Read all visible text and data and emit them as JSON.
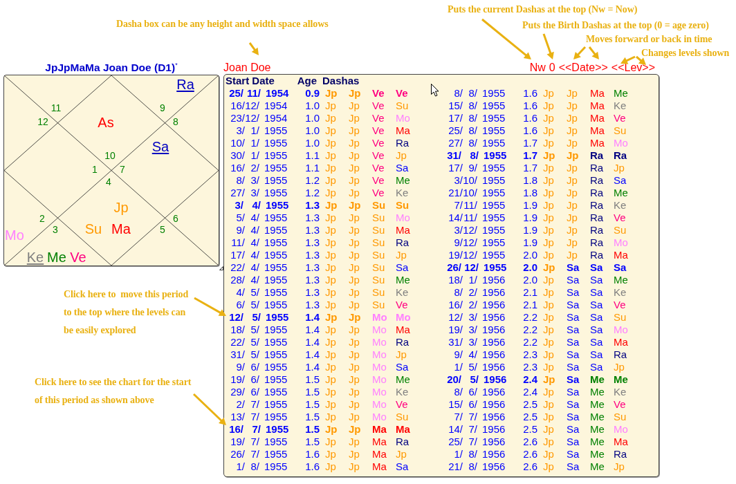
{
  "chart": {
    "title": "JpJpMaMa Joan Doe (D1)$^{*}$",
    "houses": [
      {
        "sign": "9",
        "planets": [
          {
            "name": "Ra",
            "color": "#0000c0",
            "underlined": true
          }
        ]
      },
      {
        "sign": "10",
        "planets": [
          {
            "name": "As",
            "color": "#ff0000",
            "underlined": false
          }
        ]
      },
      {
        "sign": "11"
      },
      {
        "sign": "12"
      },
      {
        "sign": "8"
      },
      {
        "sign": "1"
      },
      {
        "sign": "7",
        "planets": [
          {
            "name": "Sa",
            "color": "#0000c0",
            "underlined": true
          }
        ]
      },
      {
        "sign": "4",
        "planets": [
          {
            "name": "Jp",
            "color": "#ff9900",
            "underlined": false
          },
          {
            "name": "Su",
            "color": "#ff9900",
            "underlined": false
          },
          {
            "name": "Ma",
            "color": "#ff0000",
            "underlined": false
          }
        ]
      },
      {
        "sign": "2",
        "planets": [
          {
            "name": "Mo",
            "color": "#ff80ff",
            "underlined": false
          }
        ]
      },
      {
        "sign": "6"
      },
      {
        "sign": "3",
        "planets": [
          {
            "name": "Ke",
            "color": "#808080",
            "underlined": true
          },
          {
            "name": "Me",
            "color": "#008000",
            "underlined": false
          },
          {
            "name": "Ve",
            "color": "#ff0080",
            "underlined": false
          }
        ]
      },
      {
        "sign": "5"
      }
    ]
  },
  "dasha_panel": {
    "name": "Joan Doe",
    "navigation": [
      {
        "kind": "link",
        "label": "Nw"
      },
      {
        "kind": "link",
        "label": "0"
      },
      {
        "kind": "stepper",
        "back": "<<",
        "label": "Date",
        "forward": ">>"
      },
      {
        "kind": "stepper",
        "back": "<<",
        "label": "Lev",
        "forward": ">>"
      }
    ],
    "table": {
      "columns": [
        "Start Date",
        "Age",
        "Dashas"
      ],
      "rows": [
        {
          "start_date": "25/ 11/ 1954",
          "age": "0.9",
          "bold": true,
          "dashas": [
            {
              "text": "Jp",
              "color": "#ff9900"
            },
            {
              "text": "Jp",
              "color": "#ff9900"
            },
            {
              "text": "Ve",
              "color": "#ff0080"
            },
            {
              "text": "Ve",
              "color": "#ff0080"
            }
          ]
        },
        {
          "start_date": "16/12/ 1954",
          "age": "1.0",
          "bold": false,
          "dashas": [
            {
              "text": "Jp",
              "color": "#ff9900"
            },
            {
              "text": "Jp",
              "color": "#ff9900"
            },
            {
              "text": "Ve",
              "color": "#ff0080"
            },
            {
              "text": "Su",
              "color": "#ff9900"
            }
          ]
        },
        {
          "start_date": "23/12/ 1954",
          "age": "1.0",
          "bold": false,
          "dashas": [
            {
              "text": "Jp",
              "color": "#ff9900"
            },
            {
              "text": "Jp",
              "color": "#ff9900"
            },
            {
              "text": "Ve",
              "color": "#ff0080"
            },
            {
              "text": "Mo",
              "color": "#ff80ff"
            }
          ]
        },
        {
          "start_date": "3/ 1/ 1955",
          "age": "1.0",
          "bold": false,
          "dashas": [
            {
              "text": "Jp",
              "color": "#ff9900"
            },
            {
              "text": "Jp",
              "color": "#ff9900"
            },
            {
              "text": "Ve",
              "color": "#ff0080"
            },
            {
              "text": "Ma",
              "color": "#ff0000"
            }
          ]
        },
        {
          "start_date": "10/ 1/ 1955",
          "age": "1.0",
          "bold": false,
          "dashas": [
            {
              "text": "Jp",
              "color": "#ff9900"
            },
            {
              "text": "Jp",
              "color": "#ff9900"
            },
            {
              "text": "Ve",
              "color": "#ff0080"
            },
            {
              "text": "Ra",
              "color": "#000080"
            }
          ]
        },
        {
          "start_date": "30/ 1/ 1955",
          "age": "1.1",
          "bold": false,
          "dashas": [
            {
              "text": "Jp",
              "color": "#ff9900"
            },
            {
              "text": "Jp",
              "color": "#ff9900"
            },
            {
              "text": "Ve",
              "color": "#ff0080"
            },
            {
              "text": "Jp",
              "color": "#ff9900"
            }
          ]
        },
        {
          "start_date": "16/ 2/ 1955",
          "age": "1.1",
          "bold": false,
          "dashas": [
            {
              "text": "Jp",
              "color": "#ff9900"
            },
            {
              "text": "Jp",
              "color": "#ff9900"
            },
            {
              "text": "Ve",
              "color": "#ff0080"
            },
            {
              "text": "Sa",
              "color": "#0000ff"
            }
          ]
        },
        {
          "start_date": "8/ 3/ 1955",
          "age": "1.2",
          "bold": false,
          "dashas": [
            {
              "text": "Jp",
              "color": "#ff9900"
            },
            {
              "text": "Jp",
              "color": "#ff9900"
            },
            {
              "text": "Ve",
              "color": "#ff0080"
            },
            {
              "text": "Me",
              "color": "#008000"
            }
          ]
        },
        {
          "start_date": "27/ 3/ 1955",
          "age": "1.2",
          "bold": false,
          "dashas": [
            {
              "text": "Jp",
              "color": "#ff9900"
            },
            {
              "text": "Jp",
              "color": "#ff9900"
            },
            {
              "text": "Ve",
              "color": "#ff0080"
            },
            {
              "text": "Ke",
              "color": "#808080"
            }
          ]
        },
        {
          "start_date": "3/ 4/ 1955",
          "age": "1.3",
          "bold": true,
          "dashas": [
            {
              "text": "Jp",
              "color": "#ff9900"
            },
            {
              "text": "Jp",
              "color": "#ff9900"
            },
            {
              "text": "Su",
              "color": "#ff9900"
            },
            {
              "text": "Su",
              "color": "#ff9900"
            }
          ]
        },
        {
          "start_date": "5/ 4/ 1955",
          "age": "1.3",
          "bold": false,
          "dashas": [
            {
              "text": "Jp",
              "color": "#ff9900"
            },
            {
              "text": "Jp",
              "color": "#ff9900"
            },
            {
              "text": "Su",
              "color": "#ff9900"
            },
            {
              "text": "Mo",
              "color": "#ff80ff"
            }
          ]
        },
        {
          "start_date": "9/ 4/ 1955",
          "age": "1.3",
          "bold": false,
          "dashas": [
            {
              "text": "Jp",
              "color": "#ff9900"
            },
            {
              "text": "Jp",
              "color": "#ff9900"
            },
            {
              "text": "Su",
              "color": "#ff9900"
            },
            {
              "text": "Ma",
              "color": "#ff0000"
            }
          ]
        },
        {
          "start_date": "11/ 4/ 1955",
          "age": "1.3",
          "bold": false,
          "dashas": [
            {
              "text": "Jp",
              "color": "#ff9900"
            },
            {
              "text": "Jp",
              "color": "#ff9900"
            },
            {
              "text": "Su",
              "color": "#ff9900"
            },
            {
              "text": "Ra",
              "color": "#000080"
            }
          ]
        },
        {
          "start_date": "17/ 4/ 1955",
          "age": "1.3",
          "bold": false,
          "dashas": [
            {
              "text": "Jp",
              "color": "#ff9900"
            },
            {
              "text": "Jp",
              "color": "#ff9900"
            },
            {
              "text": "Su",
              "color": "#ff9900"
            },
            {
              "text": "Jp",
              "color": "#ff9900"
            }
          ]
        },
        {
          "start_date": "22/ 4/ 1955",
          "age": "1.3",
          "bold": false,
          "dashas": [
            {
              "text": "Jp",
              "color": "#ff9900"
            },
            {
              "text": "Jp",
              "color": "#ff9900"
            },
            {
              "text": "Su",
              "color": "#ff9900"
            },
            {
              "text": "Sa",
              "color": "#0000ff"
            }
          ]
        },
        {
          "start_date": "28/ 4/ 1955",
          "age": "1.3",
          "bold": false,
          "dashas": [
            {
              "text": "Jp",
              "color": "#ff9900"
            },
            {
              "text": "Jp",
              "color": "#ff9900"
            },
            {
              "text": "Su",
              "color": "#ff9900"
            },
            {
              "text": "Me",
              "color": "#008000"
            }
          ]
        },
        {
          "start_date": "4/ 5/ 1955",
          "age": "1.3",
          "bold": false,
          "dashas": [
            {
              "text": "Jp",
              "color": "#ff9900"
            },
            {
              "text": "Jp",
              "color": "#ff9900"
            },
            {
              "text": "Su",
              "color": "#ff9900"
            },
            {
              "text": "Ke",
              "color": "#808080"
            }
          ]
        },
        {
          "start_date": "6/ 5/ 1955",
          "age": "1.3",
          "bold": false,
          "dashas": [
            {
              "text": "Jp",
              "color": "#ff9900"
            },
            {
              "text": "Jp",
              "color": "#ff9900"
            },
            {
              "text": "Su",
              "color": "#ff9900"
            },
            {
              "text": "Ve",
              "color": "#ff0080"
            }
          ]
        },
        {
          "start_date": "12/ 5/ 1955",
          "age": "1.4",
          "bold": true,
          "dashas": [
            {
              "text": "Jp",
              "color": "#ff9900"
            },
            {
              "text": "Jp",
              "color": "#ff9900"
            },
            {
              "text": "Mo",
              "color": "#ff80ff"
            },
            {
              "text": "Mo",
              "color": "#ff80ff"
            }
          ]
        },
        {
          "start_date": "18/ 5/ 1955",
          "age": "1.4",
          "bold": false,
          "dashas": [
            {
              "text": "Jp",
              "color": "#ff9900"
            },
            {
              "text": "Jp",
              "color": "#ff9900"
            },
            {
              "text": "Mo",
              "color": "#ff80ff"
            },
            {
              "text": "Ma",
              "color": "#ff0000"
            }
          ]
        },
        {
          "start_date": "22/ 5/ 1955",
          "age": "1.4",
          "bold": false,
          "dashas": [
            {
              "text": "Jp",
              "color": "#ff9900"
            },
            {
              "text": "Jp",
              "color": "#ff9900"
            },
            {
              "text": "Mo",
              "color": "#ff80ff"
            },
            {
              "text": "Ra",
              "color": "#000080"
            }
          ]
        },
        {
          "start_date": "31/ 5/ 1955",
          "age": "1.4",
          "bold": false,
          "dashas": [
            {
              "text": "Jp",
              "color": "#ff9900"
            },
            {
              "text": "Jp",
              "color": "#ff9900"
            },
            {
              "text": "Mo",
              "color": "#ff80ff"
            },
            {
              "text": "Jp",
              "color": "#ff9900"
            }
          ]
        },
        {
          "start_date": "9/ 6/ 1955",
          "age": "1.4",
          "bold": false,
          "dashas": [
            {
              "text": "Jp",
              "color": "#ff9900"
            },
            {
              "text": "Jp",
              "color": "#ff9900"
            },
            {
              "text": "Mo",
              "color": "#ff80ff"
            },
            {
              "text": "Sa",
              "color": "#0000ff"
            }
          ]
        },
        {
          "start_date": "19/ 6/ 1955",
          "age": "1.5",
          "bold": false,
          "dashas": [
            {
              "text": "Jp",
              "color": "#ff9900"
            },
            {
              "text": "Jp",
              "color": "#ff9900"
            },
            {
              "text": "Mo",
              "color": "#ff80ff"
            },
            {
              "text": "Me",
              "color": "#008000"
            }
          ]
        },
        {
          "start_date": "29/ 6/ 1955",
          "age": "1.5",
          "bold": false,
          "dashas": [
            {
              "text": "Jp",
              "color": "#ff9900"
            },
            {
              "text": "Jp",
              "color": "#ff9900"
            },
            {
              "text": "Mo",
              "color": "#ff80ff"
            },
            {
              "text": "Ke",
              "color": "#808080"
            }
          ]
        },
        {
          "start_date": "2/ 7/ 1955",
          "age": "1.5",
          "bold": false,
          "dashas": [
            {
              "text": "Jp",
              "color": "#ff9900"
            },
            {
              "text": "Jp",
              "color": "#ff9900"
            },
            {
              "text": "Mo",
              "color": "#ff80ff"
            },
            {
              "text": "Ve",
              "color": "#ff0080"
            }
          ]
        },
        {
          "start_date": "13/ 7/ 1955",
          "age": "1.5",
          "bold": false,
          "dashas": [
            {
              "text": "Jp",
              "color": "#ff9900"
            },
            {
              "text": "Jp",
              "color": "#ff9900"
            },
            {
              "text": "Mo",
              "color": "#ff80ff"
            },
            {
              "text": "Su",
              "color": "#ff9900"
            }
          ]
        },
        {
          "start_date": "16/ 7/ 1955",
          "age": "1.5",
          "bold": true,
          "dashas": [
            {
              "text": "Jp",
              "color": "#ff9900"
            },
            {
              "text": "Jp",
              "color": "#ff9900"
            },
            {
              "text": "Ma",
              "color": "#ff0000"
            },
            {
              "text": "Ma",
              "color": "#ff0000"
            }
          ]
        },
        {
          "start_date": "19/ 7/ 1955",
          "age": "1.5",
          "bold": false,
          "dashas": [
            {
              "text": "Jp",
              "color": "#ff9900"
            },
            {
              "text": "Jp",
              "color": "#ff9900"
            },
            {
              "text": "Ma",
              "color": "#ff0000"
            },
            {
              "text": "Ra",
              "color": "#000080"
            }
          ]
        },
        {
          "start_date": "26/ 7/ 1955",
          "age": "1.6",
          "bold": false,
          "dashas": [
            {
              "text": "Jp",
              "color": "#ff9900"
            },
            {
              "text": "Jp",
              "color": "#ff9900"
            },
            {
              "text": "Ma",
              "color": "#ff0000"
            },
            {
              "text": "Jp",
              "color": "#ff9900"
            }
          ]
        },
        {
          "start_date": "1/ 8/ 1955",
          "age": "1.6",
          "bold": false,
          "dashas": [
            {
              "text": "Jp",
              "color": "#ff9900"
            },
            {
              "text": "Jp",
              "color": "#ff9900"
            },
            {
              "text": "Ma",
              "color": "#ff0000"
            },
            {
              "text": "Sa",
              "color": "#0000ff"
            }
          ]
        },
        {
          "start_date": "8/ 8/ 1955",
          "age": "1.6",
          "bold": false,
          "dashas": [
            {
              "text": "Jp",
              "color": "#ff9900"
            },
            {
              "text": "Jp",
              "color": "#ff9900"
            },
            {
              "text": "Ma",
              "color": "#ff0000"
            },
            {
              "text": "Me",
              "color": "#008000"
            }
          ]
        },
        {
          "start_date": "15/ 8/ 1955",
          "age": "1.6",
          "bold": false,
          "dashas": [
            {
              "text": "Jp",
              "color": "#ff9900"
            },
            {
              "text": "Jp",
              "color": "#ff9900"
            },
            {
              "text": "Ma",
              "color": "#ff0000"
            },
            {
              "text": "Ke",
              "color": "#808080"
            }
          ]
        },
        {
          "start_date": "17/ 8/ 1955",
          "age": "1.6",
          "bold": false,
          "dashas": [
            {
              "text": "Jp",
              "color": "#ff9900"
            },
            {
              "text": "Jp",
              "color": "#ff9900"
            },
            {
              "text": "Ma",
              "color": "#ff0000"
            },
            {
              "text": "Ve",
              "color": "#ff0080"
            }
          ]
        },
        {
          "start_date": "25/ 8/ 1955",
          "age": "1.6",
          "bold": false,
          "dashas": [
            {
              "text": "Jp",
              "color": "#ff9900"
            },
            {
              "text": "Jp",
              "color": "#ff9900"
            },
            {
              "text": "Ma",
              "color": "#ff0000"
            },
            {
              "text": "Su",
              "color": "#ff9900"
            }
          ]
        },
        {
          "start_date": "27/ 8/ 1955",
          "age": "1.7",
          "bold": false,
          "dashas": [
            {
              "text": "Jp",
              "color": "#ff9900"
            },
            {
              "text": "Jp",
              "color": "#ff9900"
            },
            {
              "text": "Ma",
              "color": "#ff0000"
            },
            {
              "text": "Mo",
              "color": "#ff80ff"
            }
          ]
        },
        {
          "start_date": "31/ 8/ 1955",
          "age": "1.7",
          "bold": true,
          "dashas": [
            {
              "text": "Jp",
              "color": "#ff9900"
            },
            {
              "text": "Jp",
              "color": "#ff9900"
            },
            {
              "text": "Ra",
              "color": "#000080"
            },
            {
              "text": "Ra",
              "color": "#000080"
            }
          ]
        },
        {
          "start_date": "17/ 9/ 1955",
          "age": "1.7",
          "bold": false,
          "dashas": [
            {
              "text": "Jp",
              "color": "#ff9900"
            },
            {
              "text": "Jp",
              "color": "#ff9900"
            },
            {
              "text": "Ra",
              "color": "#000080"
            },
            {
              "text": "Jp",
              "color": "#ff9900"
            }
          ]
        },
        {
          "start_date": "3/10/ 1955",
          "age": "1.8",
          "bold": false,
          "dashas": [
            {
              "text": "Jp",
              "color": "#ff9900"
            },
            {
              "text": "Jp",
              "color": "#ff9900"
            },
            {
              "text": "Ra",
              "color": "#000080"
            },
            {
              "text": "Sa",
              "color": "#0000ff"
            }
          ]
        },
        {
          "start_date": "21/10/ 1955",
          "age": "1.8",
          "bold": false,
          "dashas": [
            {
              "text": "Jp",
              "color": "#ff9900"
            },
            {
              "text": "Jp",
              "color": "#ff9900"
            },
            {
              "text": "Ra",
              "color": "#000080"
            },
            {
              "text": "Me",
              "color": "#008000"
            }
          ]
        },
        {
          "start_date": "7/11/ 1955",
          "age": "1.9",
          "bold": false,
          "dashas": [
            {
              "text": "Jp",
              "color": "#ff9900"
            },
            {
              "text": "Jp",
              "color": "#ff9900"
            },
            {
              "text": "Ra",
              "color": "#000080"
            },
            {
              "text": "Ke",
              "color": "#808080"
            }
          ]
        },
        {
          "start_date": "14/11/ 1955",
          "age": "1.9",
          "bold": false,
          "dashas": [
            {
              "text": "Jp",
              "color": "#ff9900"
            },
            {
              "text": "Jp",
              "color": "#ff9900"
            },
            {
              "text": "Ra",
              "color": "#000080"
            },
            {
              "text": "Ve",
              "color": "#ff0080"
            }
          ]
        },
        {
          "start_date": "3/12/ 1955",
          "age": "1.9",
          "bold": false,
          "dashas": [
            {
              "text": "Jp",
              "color": "#ff9900"
            },
            {
              "text": "Jp",
              "color": "#ff9900"
            },
            {
              "text": "Ra",
              "color": "#000080"
            },
            {
              "text": "Su",
              "color": "#ff9900"
            }
          ]
        },
        {
          "start_date": "9/12/ 1955",
          "age": "1.9",
          "bold": false,
          "dashas": [
            {
              "text": "Jp",
              "color": "#ff9900"
            },
            {
              "text": "Jp",
              "color": "#ff9900"
            },
            {
              "text": "Ra",
              "color": "#000080"
            },
            {
              "text": "Mo",
              "color": "#ff80ff"
            }
          ]
        },
        {
          "start_date": "19/12/ 1955",
          "age": "2.0",
          "bold": false,
          "dashas": [
            {
              "text": "Jp",
              "color": "#ff9900"
            },
            {
              "text": "Jp",
              "color": "#ff9900"
            },
            {
              "text": "Ra",
              "color": "#000080"
            },
            {
              "text": "Ma",
              "color": "#ff0000"
            }
          ]
        },
        {
          "start_date": "26/ 12/ 1955",
          "age": "2.0",
          "bold": true,
          "dashas": [
            {
              "text": "Jp",
              "color": "#ff9900"
            },
            {
              "text": "Sa",
              "color": "#0000ff"
            },
            {
              "text": "Sa",
              "color": "#0000ff"
            },
            {
              "text": "Sa",
              "color": "#0000ff"
            }
          ]
        },
        {
          "start_date": "18/ 1/ 1956",
          "age": "2.0",
          "bold": false,
          "dashas": [
            {
              "text": "Jp",
              "color": "#ff9900"
            },
            {
              "text": "Sa",
              "color": "#0000ff"
            },
            {
              "text": "Sa",
              "color": "#0000ff"
            },
            {
              "text": "Me",
              "color": "#008000"
            }
          ]
        },
        {
          "start_date": "8/ 2/ 1956",
          "age": "2.1",
          "bold": false,
          "dashas": [
            {
              "text": "Jp",
              "color": "#ff9900"
            },
            {
              "text": "Sa",
              "color": "#0000ff"
            },
            {
              "text": "Sa",
              "color": "#0000ff"
            },
            {
              "text": "Ke",
              "color": "#808080"
            }
          ]
        },
        {
          "start_date": "16/ 2/ 1956",
          "age": "2.1",
          "bold": false,
          "dashas": [
            {
              "text": "Jp",
              "color": "#ff9900"
            },
            {
              "text": "Sa",
              "color": "#0000ff"
            },
            {
              "text": "Sa",
              "color": "#0000ff"
            },
            {
              "text": "Ve",
              "color": "#ff0080"
            }
          ]
        },
        {
          "start_date": "12/ 3/ 1956",
          "age": "2.2",
          "bold": false,
          "dashas": [
            {
              "text": "Jp",
              "color": "#ff9900"
            },
            {
              "text": "Sa",
              "color": "#0000ff"
            },
            {
              "text": "Sa",
              "color": "#0000ff"
            },
            {
              "text": "Su",
              "color": "#ff9900"
            }
          ]
        },
        {
          "start_date": "19/ 3/ 1956",
          "age": "2.2",
          "bold": false,
          "dashas": [
            {
              "text": "Jp",
              "color": "#ff9900"
            },
            {
              "text": "Sa",
              "color": "#0000ff"
            },
            {
              "text": "Sa",
              "color": "#0000ff"
            },
            {
              "text": "Mo",
              "color": "#ff80ff"
            }
          ]
        },
        {
          "start_date": "31/ 3/ 1956",
          "age": "2.2",
          "bold": false,
          "dashas": [
            {
              "text": "Jp",
              "color": "#ff9900"
            },
            {
              "text": "Sa",
              "color": "#0000ff"
            },
            {
              "text": "Sa",
              "color": "#0000ff"
            },
            {
              "text": "Ma",
              "color": "#ff0000"
            }
          ]
        },
        {
          "start_date": "9/ 4/ 1956",
          "age": "2.3",
          "bold": false,
          "dashas": [
            {
              "text": "Jp",
              "color": "#ff9900"
            },
            {
              "text": "Sa",
              "color": "#0000ff"
            },
            {
              "text": "Sa",
              "color": "#0000ff"
            },
            {
              "text": "Ra",
              "color": "#000080"
            }
          ]
        },
        {
          "start_date": "1/ 5/ 1956",
          "age": "2.3",
          "bold": false,
          "dashas": [
            {
              "text": "Jp",
              "color": "#ff9900"
            },
            {
              "text": "Sa",
              "color": "#0000ff"
            },
            {
              "text": "Sa",
              "color": "#0000ff"
            },
            {
              "text": "Jp",
              "color": "#ff9900"
            }
          ]
        },
        {
          "start_date": "20/ 5/ 1956",
          "age": "2.4",
          "bold": true,
          "dashas": [
            {
              "text": "Jp",
              "color": "#ff9900"
            },
            {
              "text": "Sa",
              "color": "#0000ff"
            },
            {
              "text": "Me",
              "color": "#008000"
            },
            {
              "text": "Me",
              "color": "#008000"
            }
          ]
        },
        {
          "start_date": "8/ 6/ 1956",
          "age": "2.4",
          "bold": false,
          "dashas": [
            {
              "text": "Jp",
              "color": "#ff9900"
            },
            {
              "text": "Sa",
              "color": "#0000ff"
            },
            {
              "text": "Me",
              "color": "#008000"
            },
            {
              "text": "Ke",
              "color": "#808080"
            }
          ]
        },
        {
          "start_date": "15/ 6/ 1956",
          "age": "2.5",
          "bold": false,
          "dashas": [
            {
              "text": "Jp",
              "color": "#ff9900"
            },
            {
              "text": "Sa",
              "color": "#0000ff"
            },
            {
              "text": "Me",
              "color": "#008000"
            },
            {
              "text": "Ve",
              "color": "#ff0080"
            }
          ]
        },
        {
          "start_date": "7/ 7/ 1956",
          "age": "2.5",
          "bold": false,
          "dashas": [
            {
              "text": "Jp",
              "color": "#ff9900"
            },
            {
              "text": "Sa",
              "color": "#0000ff"
            },
            {
              "text": "Me",
              "color": "#008000"
            },
            {
              "text": "Su",
              "color": "#ff9900"
            }
          ]
        },
        {
          "start_date": "14/ 7/ 1956",
          "age": "2.5",
          "bold": false,
          "dashas": [
            {
              "text": "Jp",
              "color": "#ff9900"
            },
            {
              "text": "Sa",
              "color": "#0000ff"
            },
            {
              "text": "Me",
              "color": "#008000"
            },
            {
              "text": "Mo",
              "color": "#ff80ff"
            }
          ]
        },
        {
          "start_date": "25/ 7/ 1956",
          "age": "2.6",
          "bold": false,
          "dashas": [
            {
              "text": "Jp",
              "color": "#ff9900"
            },
            {
              "text": "Sa",
              "color": "#0000ff"
            },
            {
              "text": "Me",
              "color": "#008000"
            },
            {
              "text": "Ma",
              "color": "#ff0000"
            }
          ]
        },
        {
          "start_date": "1/ 8/ 1956",
          "age": "2.6",
          "bold": false,
          "dashas": [
            {
              "text": "Jp",
              "color": "#ff9900"
            },
            {
              "text": "Sa",
              "color": "#0000ff"
            },
            {
              "text": "Me",
              "color": "#008000"
            },
            {
              "text": "Ra",
              "color": "#000080"
            }
          ]
        },
        {
          "start_date": "21/ 8/ 1956",
          "age": "2.6",
          "bold": false,
          "dashas": [
            {
              "text": "Jp",
              "color": "#ff9900"
            },
            {
              "text": "Sa",
              "color": "#0000ff"
            },
            {
              "text": "Me",
              "color": "#008000"
            },
            {
              "text": "Jp",
              "color": "#ff9900"
            }
          ]
        }
      ]
    }
  },
  "annotations": [
    {
      "text": "Dasha box can be any height and width space allows"
    },
    {
      "text": "Puts the current Dashas at the top (Nw = Now)"
    },
    {
      "text": "Puts the Birth Dashas at the top (0 = age zero)"
    },
    {
      "text": "Moves forward or back in time"
    },
    {
      "text": "Changes levels shown"
    },
    {
      "text": "Click here to  move this period\nto the top where the levels can\nbe easily explored"
    },
    {
      "text": "Click here to see the chart for the start\nof this period as shown above"
    }
  ]
}
